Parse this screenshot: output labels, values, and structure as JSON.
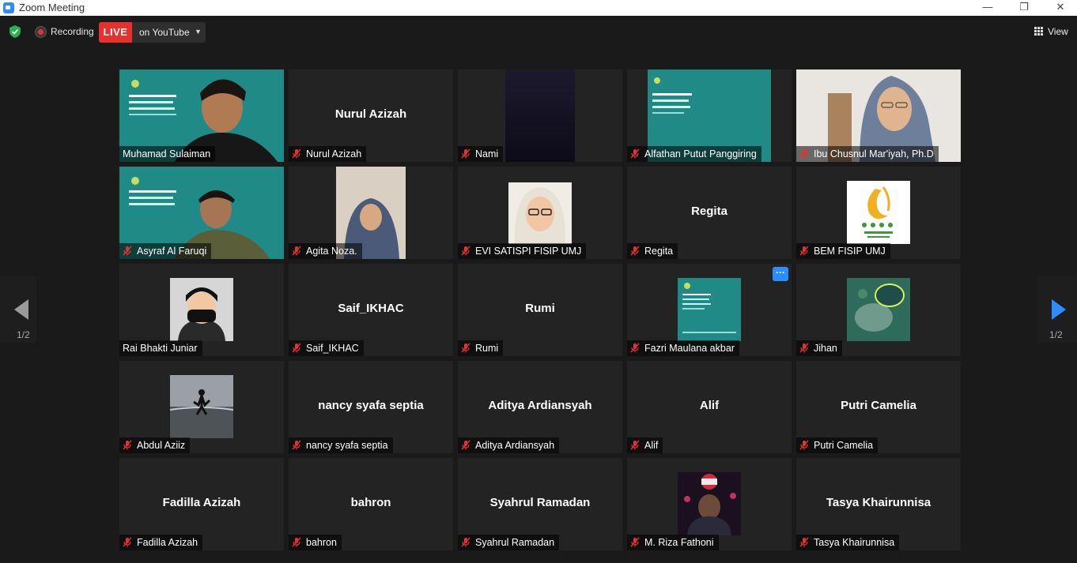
{
  "window": {
    "title": "Zoom Meeting",
    "minimize": "—",
    "restore": "❐",
    "close": "✕"
  },
  "toolbar": {
    "recording_label": "Recording",
    "live_badge": "LIVE",
    "live_platform": "on YouTube",
    "view_label": "View"
  },
  "pagination": {
    "left_page": "1/2",
    "right_page": "1/2"
  },
  "colors": {
    "accent": "#2d8cff",
    "live": "#e8312f",
    "active_speaker": "#c9dc62",
    "muted": "#e8312f"
  },
  "participants": [
    {
      "name": "Muhamad Sulaiman",
      "display": "",
      "muted": false
    },
    {
      "name": "Nurul Azizah",
      "display": "Nurul Azizah",
      "muted": true
    },
    {
      "name": "Nami",
      "display": "",
      "muted": true
    },
    {
      "name": "Alfathan Putut Panggiring",
      "display": "",
      "muted": true
    },
    {
      "name": "Ibu Chusnul Mar'iyah, Ph.D",
      "display": "",
      "muted": true
    },
    {
      "name": "Asyraf Al Faruqi",
      "display": "",
      "muted": true
    },
    {
      "name": "Agita Noza.",
      "display": "",
      "muted": true
    },
    {
      "name": "EVI SATISPI FISIP UMJ",
      "display": "",
      "muted": true
    },
    {
      "name": "Regita",
      "display": "Regita",
      "muted": true
    },
    {
      "name": "BEM FISIP UMJ",
      "display": "",
      "muted": true
    },
    {
      "name": "Rai Bhakti Juniar",
      "display": "",
      "muted": false
    },
    {
      "name": "Saif_IKHAC",
      "display": "Saif_IKHAC",
      "muted": true
    },
    {
      "name": "Rumi",
      "display": "Rumi",
      "muted": true
    },
    {
      "name": "Fazri Maulana akbar",
      "display": "",
      "muted": true
    },
    {
      "name": "Jihan",
      "display": "",
      "muted": true
    },
    {
      "name": "Abdul Aziiz",
      "display": "",
      "muted": true
    },
    {
      "name": "nancy syafa septia",
      "display": "nancy syafa septia",
      "muted": true
    },
    {
      "name": "Aditya Ardiansyah",
      "display": "Aditya Ardiansyah",
      "muted": true
    },
    {
      "name": "Alif",
      "display": "Alif",
      "muted": true
    },
    {
      "name": "Putri Camelia",
      "display": "Putri Camelia",
      "muted": true
    },
    {
      "name": "Fadilla Azizah",
      "display": "Fadilla Azizah",
      "muted": true
    },
    {
      "name": "bahron",
      "display": "bahron",
      "muted": true
    },
    {
      "name": "Syahrul Ramadan",
      "display": "Syahrul Ramadan",
      "muted": true
    },
    {
      "name": "M. Riza Fathoni",
      "display": "",
      "muted": true
    },
    {
      "name": "Tasya Khairunnisa",
      "display": "Tasya Khairunnisa",
      "muted": true
    }
  ],
  "more_button": "···"
}
